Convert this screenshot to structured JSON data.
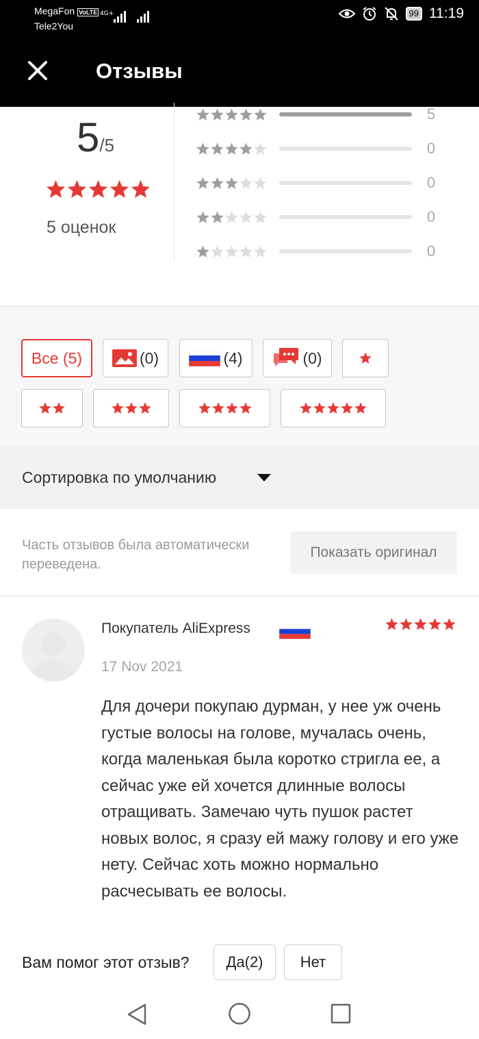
{
  "status_bar": {
    "carrier_1": "MegaFon",
    "volte": "VoLTE",
    "network": "4G+",
    "carrier_2": "Tele2You",
    "battery": "99",
    "time": "11:19"
  },
  "header": {
    "title": "Отзывы"
  },
  "rating": {
    "score": "5",
    "max": "/5",
    "stars": 5,
    "count_label": "5 оценок",
    "breakdown": [
      {
        "stars": 5,
        "count": "5",
        "fraction": 1.0
      },
      {
        "stars": 4,
        "count": "0",
        "fraction": 0
      },
      {
        "stars": 3,
        "count": "0",
        "fraction": 0
      },
      {
        "stars": 2,
        "count": "0",
        "fraction": 0
      },
      {
        "stars": 1,
        "count": "0",
        "fraction": 0
      }
    ]
  },
  "filters": {
    "all": "Все (5)",
    "photo": "(0)",
    "russia": "(4)",
    "comments": "(0)",
    "star_1": "1",
    "star_2": "2",
    "star_3": "3",
    "star_4": "4",
    "star_5": "5"
  },
  "sort": {
    "label": "Сортировка по умолчанию"
  },
  "translation": {
    "note": "Часть отзывов была автоматически переведена.",
    "button": "Показать оригинал"
  },
  "review": {
    "author": "Покупатель AliExpress",
    "rating": 5,
    "date": "17 Nov 2021",
    "text": "Для дочери покупаю дурман, у нее уж очень густые волосы на голове, мучалась очень, когда маленькая была коротко стригла ее, а сейчас уже ей хочется длинные волосы отращивать. Замечаю чуть пушок растет новых волос, я сразу ей мажу голову и его уже нету. Сейчас хоть можно нормально расчесывать ее волосы.",
    "helpful_question": "Вам помог этот отзыв?",
    "yes_label": "Да(2)",
    "no_label": "Нет"
  },
  "colors": {
    "accent": "#e53935",
    "header_bg": "#000000",
    "star_empty": "#dddddd",
    "star_gray": "#9e9e9e"
  }
}
